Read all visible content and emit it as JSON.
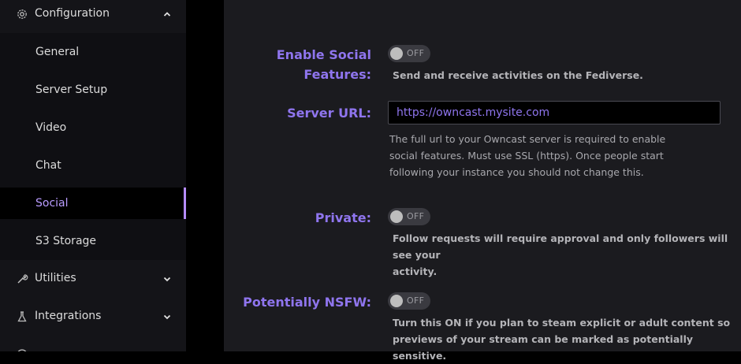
{
  "sidebar": {
    "configuration": {
      "label": "Configuration",
      "icon": "gear-icon"
    },
    "sub_items": [
      {
        "label": "General"
      },
      {
        "label": "Server Setup"
      },
      {
        "label": "Video"
      },
      {
        "label": "Chat"
      },
      {
        "label": "Social",
        "selected": true
      },
      {
        "label": "S3 Storage"
      }
    ],
    "utilities": {
      "label": "Utilities",
      "icon": "wrench-icon"
    },
    "integrations": {
      "label": "Integrations",
      "icon": "flask-icon"
    }
  },
  "form": {
    "enable_social": {
      "label_line1": "Enable Social",
      "label_line2": "Features:",
      "toggle": "OFF",
      "help": "Send and receive activities on the Fediverse."
    },
    "server_url": {
      "label": "Server URL:",
      "placeholder": "https://owncast.mysite.com",
      "help_line1": "The full url to your Owncast server is required to enable",
      "help_line2": "social features. Must use SSL (https). Once people start",
      "help_line3": "following your instance you should not change this."
    },
    "private": {
      "label": "Private:",
      "toggle": "OFF",
      "help_line1": "Follow requests will require approval and only followers will see your",
      "help_line2": "activity."
    },
    "nsfw": {
      "label": "Potentially NSFW:",
      "toggle": "OFF",
      "help_line1": "Turn this ON if you plan to steam explicit or adult content so",
      "help_line2": "previews of your stream can be marked as potentially sensitive."
    }
  },
  "colors": {
    "accent": "#8f75ee",
    "selected_text": "#b99cff",
    "sidebar_bg": "#141418",
    "main_bg": "#1b1b1f"
  }
}
